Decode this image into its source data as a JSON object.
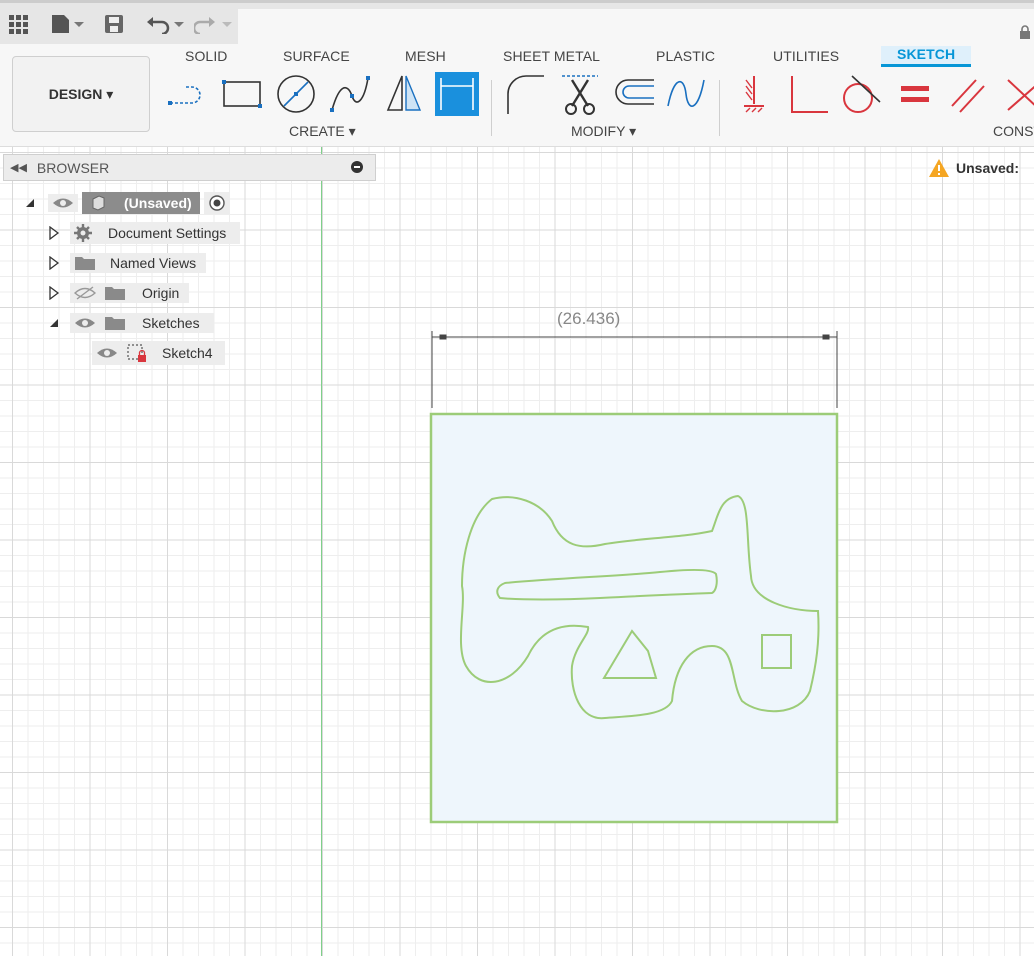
{
  "tabs": [
    "SOLID",
    "SURFACE",
    "MESH",
    "SHEET METAL",
    "PLASTIC",
    "UTILITIES",
    "SKETCH"
  ],
  "active_tab": "SKETCH",
  "workspace_button": "DESIGN ▾",
  "groups": {
    "create": "CREATE ▾",
    "modify": "MODIFY ▾",
    "constraints": "CONST"
  },
  "browser": {
    "title": "BROWSER",
    "root": "(Unsaved)",
    "items": [
      {
        "label": "Document Settings",
        "icon": "gear-icon"
      },
      {
        "label": "Named Views",
        "icon": "folder-icon"
      },
      {
        "label": "Origin",
        "icon": "folder-icon"
      },
      {
        "label": "Sketches",
        "icon": "folder-icon"
      },
      {
        "label": "Sketch4",
        "icon": "sketch-icon"
      }
    ]
  },
  "status": {
    "unsaved_label": "Unsaved:"
  },
  "sketch": {
    "dimension": "(26.436)"
  },
  "colors": {
    "accent": "#0696d7",
    "sketch_line": "#9ccc78",
    "sketch_fill": "#eef6fc",
    "constraint": "#d9363e"
  }
}
